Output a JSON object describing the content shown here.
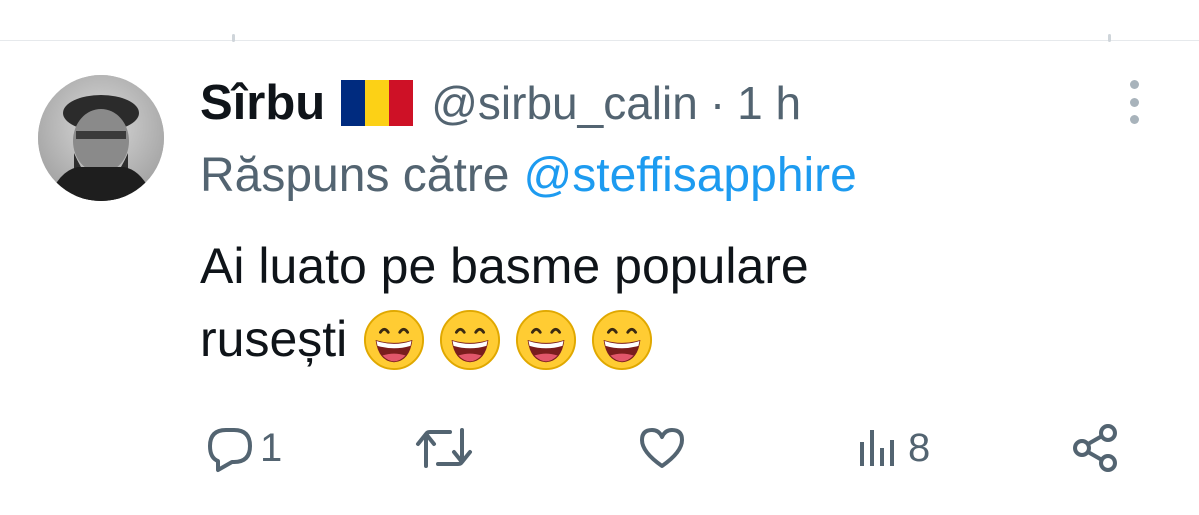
{
  "tweet": {
    "display_name": "Sîrbu",
    "handle": "@sirbu_calin",
    "separator": "·",
    "time": "1 h",
    "reply_prefix": "Răspuns către",
    "reply_to": "@steffisapphire",
    "text_line1": "Ai luato pe basme populare",
    "text_line2": "rusești",
    "emoji_names": [
      "grinning-face-icon",
      "grinning-face-icon",
      "grinning-face-icon",
      "grinning-face-icon"
    ],
    "flag_colors": [
      "#002b7f",
      "#fcd116",
      "#ce1126"
    ]
  },
  "actions": {
    "reply_count": "1",
    "retweet_count": "",
    "like_count": "",
    "views_count": "8"
  },
  "colors": {
    "text_primary": "#0f1419",
    "text_secondary": "#536471",
    "link": "#1d9bf0",
    "divider": "#e6e9ec"
  }
}
